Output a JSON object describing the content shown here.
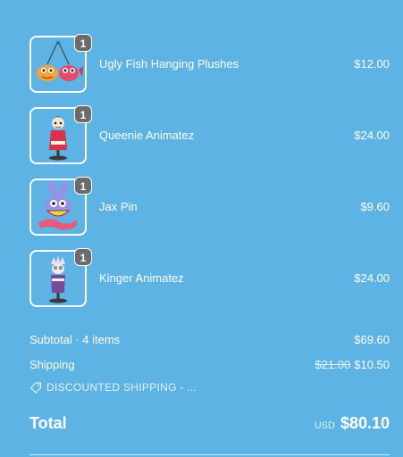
{
  "items": [
    {
      "name": "Ugly Fish Hanging Plushes",
      "price": "$12.00",
      "quantity": "1",
      "icon": "fish-plush-icon"
    },
    {
      "name": "Queenie Animatez",
      "price": "$24.00",
      "quantity": "1",
      "icon": "queenie-figure-icon"
    },
    {
      "name": "Jax Pin",
      "price": "$9.60",
      "quantity": "1",
      "icon": "jax-pin-icon"
    },
    {
      "name": "Kinger Animatez",
      "price": "$24.00",
      "quantity": "1",
      "icon": "kinger-figure-icon"
    }
  ],
  "subtotal": {
    "label": "Subtotal · 4 items",
    "value": "$69.60"
  },
  "shipping": {
    "label": "Shipping",
    "original": "$21.00",
    "value": "$10.50"
  },
  "discount": {
    "label": "DISCOUNTED SHIPPING - ...",
    "icon": "tag-icon"
  },
  "total": {
    "label": "Total",
    "currency": "USD",
    "value": "$80.10"
  },
  "colors": {
    "background": "#5db3e3",
    "badge": "#6b6b6b",
    "text": "#ffffff"
  }
}
